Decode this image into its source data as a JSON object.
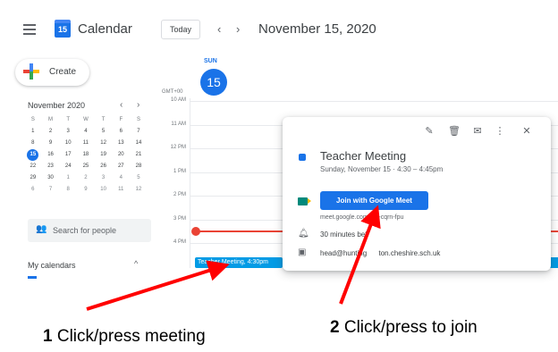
{
  "header": {
    "app_name": "Calendar",
    "logo_day": "15",
    "today_button": "Today",
    "prev_icon": "‹",
    "next_icon": "›",
    "current_date": "November 15, 2020"
  },
  "sidebar": {
    "create_label": "Create",
    "mini_calendar": {
      "title": "November 2020",
      "prev": "‹",
      "next": "›",
      "weekdays": [
        "S",
        "M",
        "T",
        "W",
        "T",
        "F",
        "S"
      ],
      "weeks": [
        [
          "1",
          "2",
          "3",
          "4",
          "5",
          "6",
          "7"
        ],
        [
          "8",
          "9",
          "10",
          "11",
          "12",
          "13",
          "14"
        ],
        [
          "15",
          "16",
          "17",
          "18",
          "19",
          "20",
          "21"
        ],
        [
          "22",
          "23",
          "24",
          "25",
          "26",
          "27",
          "28"
        ],
        [
          "29",
          "30",
          "1",
          "2",
          "3",
          "4",
          "5"
        ],
        [
          "6",
          "7",
          "8",
          "9",
          "10",
          "11",
          "12"
        ]
      ],
      "selected_day": "15"
    },
    "search_people_placeholder": "Search for people",
    "my_calendars_label": "My calendars",
    "my_calendars_chevron": "^"
  },
  "day_view": {
    "weekday": "SUN",
    "day_number": "15",
    "timezone": "GMT+00",
    "time_labels": [
      "10 AM",
      "11 AM",
      "12 PM",
      "1 PM",
      "2 PM",
      "3 PM",
      "4 PM"
    ],
    "event_chip": "Teacher Meeting, 4:30pm"
  },
  "popup": {
    "edit_icon": "✎",
    "delete_icon": "🗑",
    "email_icon": "✉",
    "more_icon": "⋮",
    "close_icon": "✕",
    "event_title": "Teacher Meeting",
    "event_when": "Sunday, November 15  ·  4:30 – 4:45pm",
    "join_button": "Join with Google Meet",
    "meet_link": "meet.google.com/bu -cqrn-fpu",
    "reminder": "30 minutes bef",
    "organizer": "head@hunting      ton.cheshire.sch.uk",
    "reminder_icon": "bell-icon",
    "organizer_icon": "calendar-icon"
  },
  "annotations": {
    "step1_number": "1",
    "step1_text": " Click/press meeting",
    "step2_number": "2",
    "step2_text": " Click/press to join",
    "arrow_color": "#ff0000"
  }
}
